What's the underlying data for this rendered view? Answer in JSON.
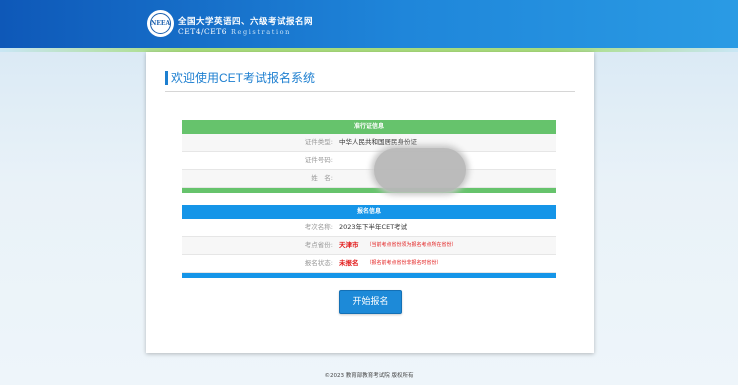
{
  "header": {
    "logo_text": "NEEA",
    "title": "全国大学英语四、六级考试报名网",
    "subtitle": "CET4/CET6",
    "subtitle_en": "Registration"
  },
  "main": {
    "welcome": "欢迎使用CET考试报名系统",
    "pass_info": {
      "header": "准行证信息",
      "rows": [
        {
          "label": "证件类型:",
          "value": "中华人民共和国居民身份证"
        },
        {
          "label": "证件号码:",
          "value": ""
        },
        {
          "label": "姓　名:",
          "value": ""
        }
      ]
    },
    "reg_info": {
      "header": "报名信息",
      "rows": [
        {
          "label": "考次名称:",
          "value": "2023年下半年CET考试",
          "note": ""
        },
        {
          "label": "考点省份:",
          "value": "天津市",
          "note": "（当前考点省份须为报名考点所在省份）"
        },
        {
          "label": "报名状态:",
          "value": "未报名",
          "note": "（报名前考点省份非报名时省份）"
        }
      ]
    },
    "start_button": "开始报名"
  },
  "footer": {
    "text": "©2023  教育部教育考试院  版权所有"
  },
  "colors": {
    "header_blue": "#1f86da",
    "pass_green": "#66c36c",
    "reg_blue": "#1595e8",
    "alert_red": "#e21a1a"
  }
}
